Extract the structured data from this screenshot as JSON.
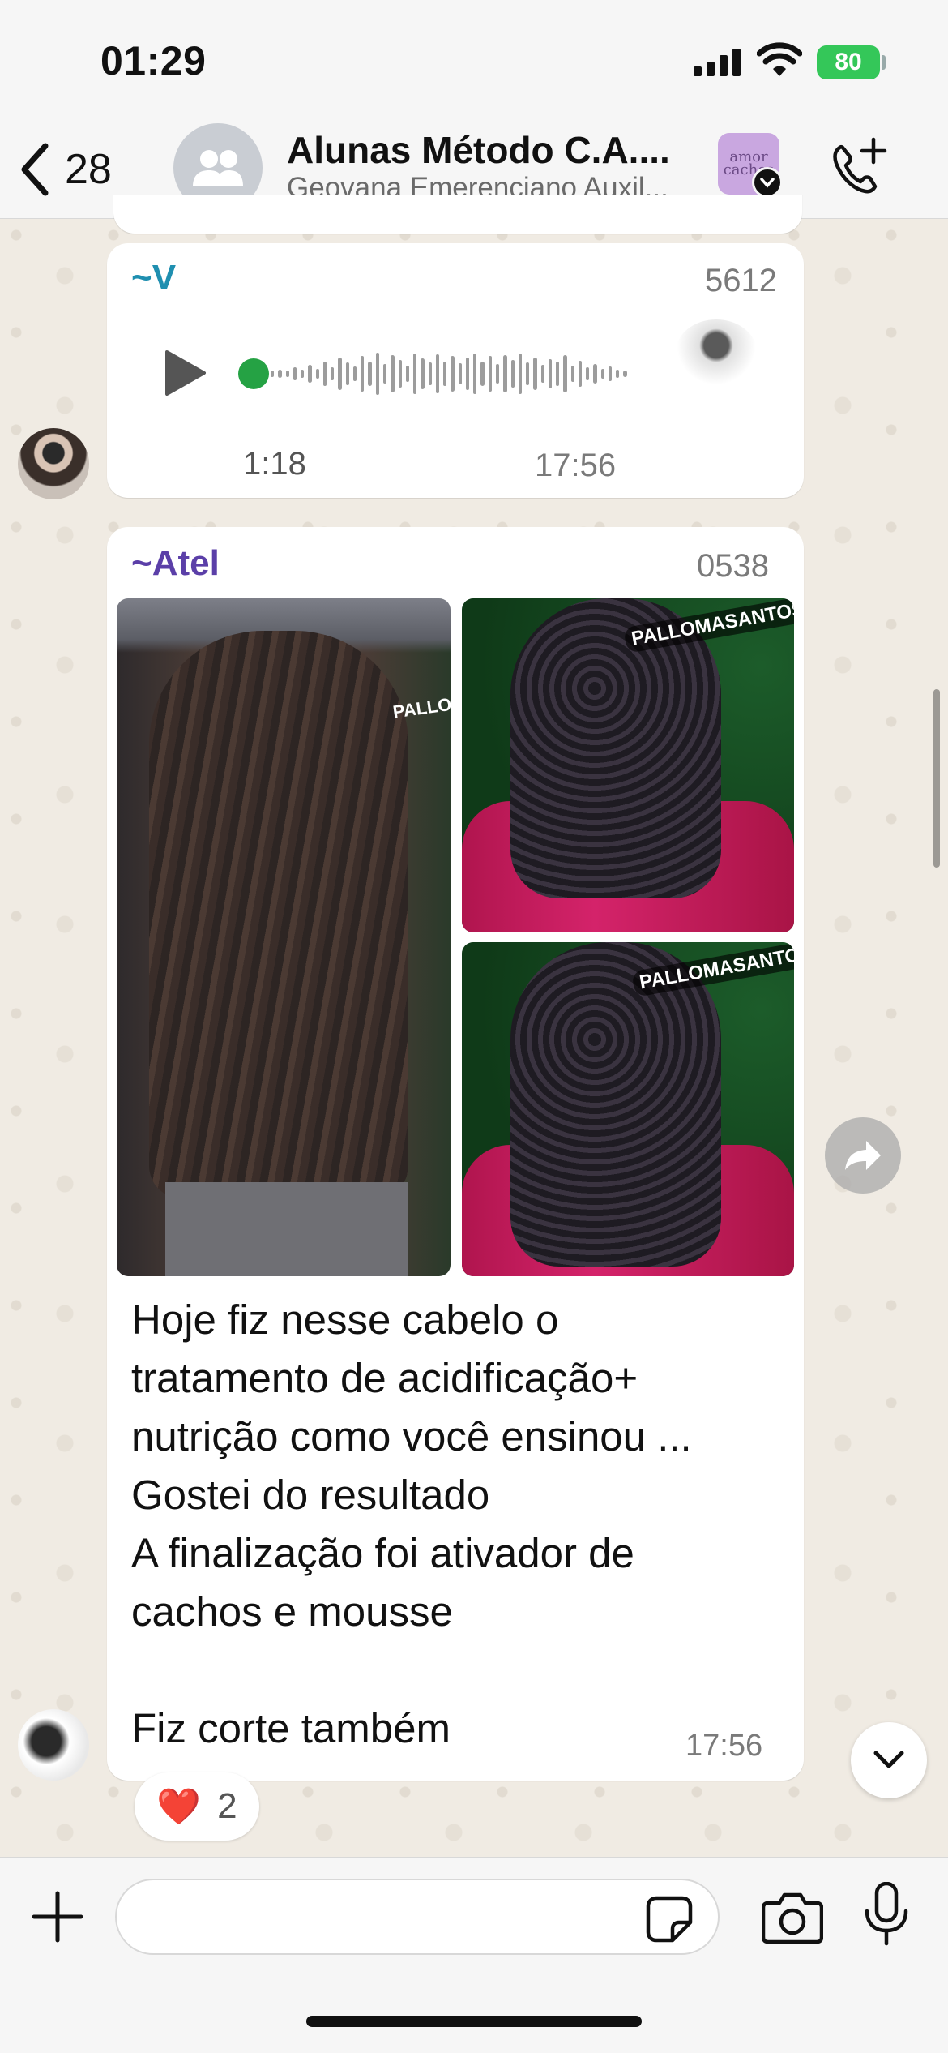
{
  "status_bar": {
    "time": "01:29",
    "battery": "80"
  },
  "header": {
    "back_count": "28",
    "chat_title": "Alunas Método C.A....",
    "chat_subtitle": "Geovana Emerenciano Auxil...",
    "group_logo_text": "amor cachos",
    "accent_color": "#8e5fbf"
  },
  "messages": [
    {
      "type": "audio",
      "sender_name": "~V",
      "sender_phone": "5612",
      "sender_color": "#1f8fb0",
      "duration": "1:18",
      "time": "17:56"
    },
    {
      "type": "images-with-text",
      "sender_name": "~Atel",
      "sender_phone": "0538",
      "sender_color": "#5b3fa8",
      "photo_watermark": "PALLOMASANTOS",
      "text": "Hoje fiz nesse cabelo o\ntratamento de acidificação+\nnutrição como você ensinou ...\nGostei do resultado\nA finalização foi ativador de\ncachos e mousse\n\nFiz corte também",
      "time": "17:56",
      "reaction": {
        "emoji": "❤️",
        "count": "2"
      }
    }
  ],
  "input": {
    "placeholder": ""
  },
  "colors": {
    "wallpaper": "#f0ebe3",
    "bubble": "#ffffff",
    "audio_dot": "#25a244",
    "battery": "#34c759"
  }
}
